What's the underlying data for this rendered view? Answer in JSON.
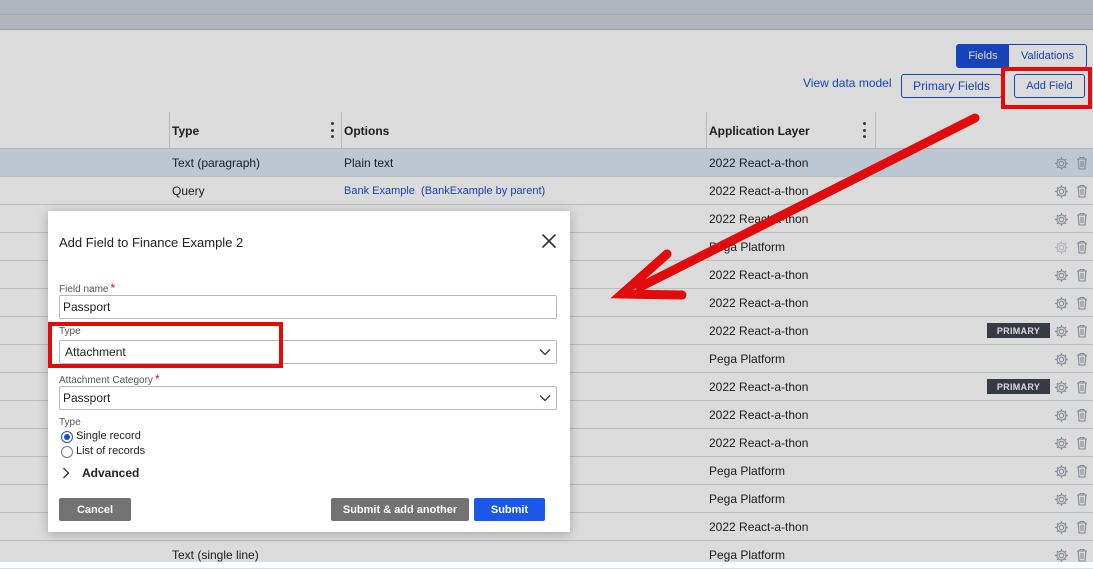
{
  "toolbar": {
    "view_switch": [
      "Fields",
      "Validations"
    ],
    "view_data_model": "View data model",
    "primary_fields": "Primary Fields",
    "add_field": "Add Field"
  },
  "table": {
    "columns": [
      "Type",
      "Options",
      "Application Layer"
    ],
    "rows": [
      {
        "type": "Text (paragraph)",
        "options": "Plain text",
        "layer": "2022 React-a-thon",
        "selected": true
      },
      {
        "type": "Query",
        "options_link1": "Bank Example",
        "options_link2": "BankExample by parent",
        "layer": "2022 React-a-thon"
      },
      {
        "type": "",
        "options": "",
        "layer": "2022 React-a-thon"
      },
      {
        "type": "",
        "options": "",
        "layer": "Pega Platform"
      },
      {
        "type": "",
        "options": "",
        "layer": "2022 React-a-thon"
      },
      {
        "type": "",
        "options": "",
        "layer": "2022 React-a-thon"
      },
      {
        "type": "",
        "options": "",
        "layer": "2022 React-a-thon",
        "badge": "PRIMARY"
      },
      {
        "type": "",
        "options": "",
        "layer": "Pega Platform"
      },
      {
        "type": "",
        "options": "",
        "layer": "2022 React-a-thon",
        "badge": "PRIMARY"
      },
      {
        "type": "",
        "options": "",
        "layer": "2022 React-a-thon"
      },
      {
        "type": "",
        "options": "",
        "layer": "2022 React-a-thon"
      },
      {
        "type": "",
        "options": "",
        "layer": "Pega Platform"
      },
      {
        "type": "",
        "options": "",
        "layer": "Pega Platform"
      },
      {
        "type": "",
        "options": "",
        "layer": "2022 React-a-thon"
      },
      {
        "type": "Text (single line)",
        "options": "",
        "layer": "Pega Platform"
      }
    ]
  },
  "modal": {
    "title": "Add Field to Finance Example 2",
    "field_name_label": "Field name",
    "field_name_value": "Passport",
    "type_label": "Type",
    "type_value": "Attachment",
    "attachment_category_label": "Attachment Category",
    "attachment_category_value": "Passport",
    "record_type_label": "Type",
    "radio_single": "Single record",
    "radio_list": "List of records",
    "advanced": "Advanced",
    "cancel": "Cancel",
    "submit_another": "Submit & add another",
    "submit": "Submit"
  },
  "icons": {
    "gear": "gear-icon",
    "trash": "trash-icon",
    "close": "close-icon",
    "chevron_down": "chevron-down-icon",
    "chevron_right": "chevron-right-icon"
  },
  "colors": {
    "accent": "#1b4ed8",
    "annotation_red": "#e20a0a",
    "selected_row": "#dbe8f7",
    "badge": "#3d4452",
    "secondary_button": "#737373"
  }
}
